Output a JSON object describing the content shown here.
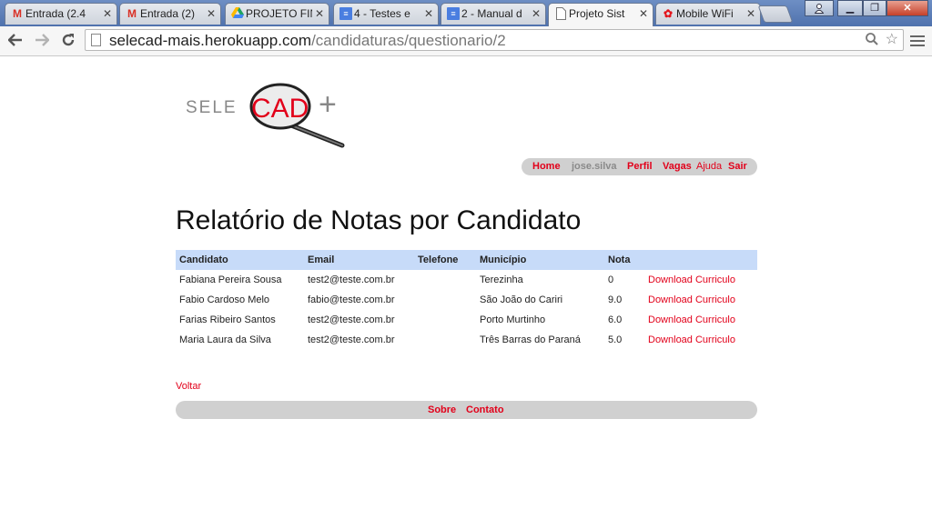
{
  "browser": {
    "tabs": [
      {
        "title": "Entrada (2.4",
        "icon": "gmail-icon"
      },
      {
        "title": "Entrada (2)",
        "icon": "gmail-icon"
      },
      {
        "title": "PROJETO FIN",
        "icon": "drive-icon"
      },
      {
        "title": "4 - Testes e",
        "icon": "docs-icon"
      },
      {
        "title": "2 - Manual d",
        "icon": "docs-icon"
      },
      {
        "title": "Projeto Sist",
        "icon": "page-icon"
      },
      {
        "title": "Mobile WiFi",
        "icon": "huawei-icon"
      }
    ],
    "url_host": "selecad-mais.herokuapp.com",
    "url_path": "/candidaturas/questionario/2"
  },
  "logo": {
    "left_text": "SELE",
    "center_text": "CAD",
    "plus": "+"
  },
  "topnav": {
    "home": "Home",
    "user": "jose.silva",
    "perfil": "Perfil",
    "vagas": "Vagas",
    "ajuda": "Ajuda",
    "sair": "Sair"
  },
  "page": {
    "title": "Relatório de Notas por Candidato"
  },
  "table": {
    "headers": [
      "Candidato",
      "Email",
      "Telefone",
      "Município",
      "Nota"
    ],
    "rows": [
      {
        "candidato": "Fabiana Pereira Sousa",
        "email": "test2@teste.com.br",
        "telefone": "",
        "municipio": "Terezinha",
        "nota": "0",
        "download": "Download Curriculo"
      },
      {
        "candidato": "Fabio Cardoso Melo",
        "email": "fabio@teste.com.br",
        "telefone": "",
        "municipio": "São João do Cariri",
        "nota": "9.0",
        "download": "Download Curriculo"
      },
      {
        "candidato": "Farias Ribeiro Santos",
        "email": "test2@teste.com.br",
        "telefone": "",
        "municipio": "Porto Murtinho",
        "nota": "6.0",
        "download": "Download Curriculo"
      },
      {
        "candidato": "Maria Laura da Silva",
        "email": "test2@teste.com.br",
        "telefone": "",
        "municipio": "Três Barras do Paraná",
        "nota": "5.0",
        "download": "Download Curriculo"
      }
    ]
  },
  "voltar": "Voltar",
  "footer": {
    "sobre": "Sobre",
    "contato": "Contato"
  },
  "colors": {
    "link": "#e2001a",
    "table_header": "#c7dbf9",
    "nav_bg": "#d0d0d0"
  }
}
